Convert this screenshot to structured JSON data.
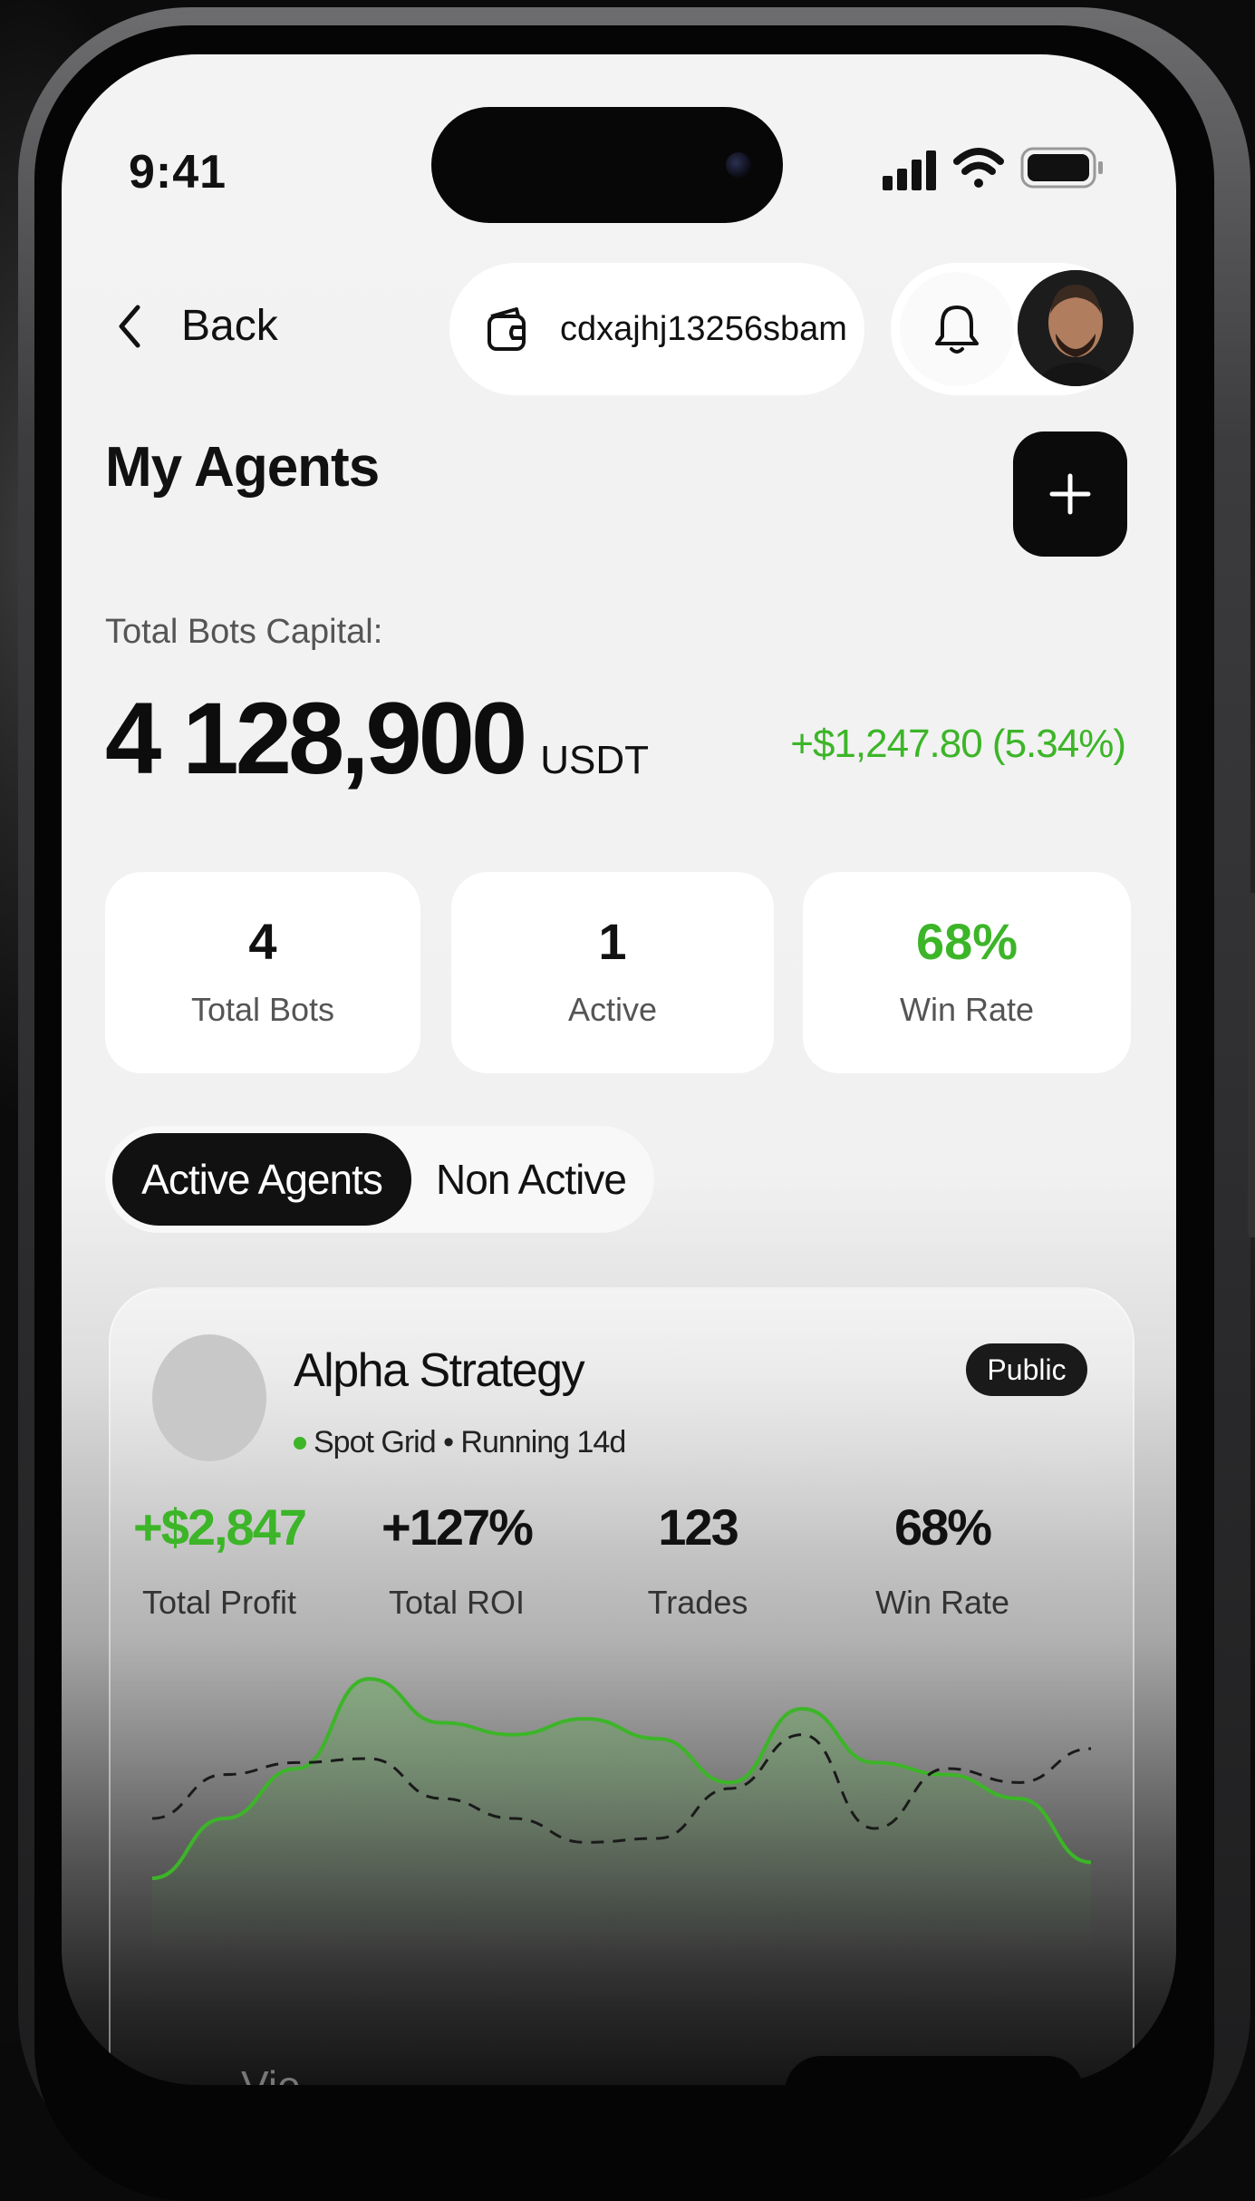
{
  "status_bar": {
    "time": "9:41"
  },
  "header": {
    "back_label": "Back",
    "wallet_address": "cdxajhj13256sbam"
  },
  "page": {
    "title": "My Agents"
  },
  "capital": {
    "label": "Total Bots Capital:",
    "value": "4 128,900",
    "unit": "USDT",
    "change": "+$1,247.80 (5.34%)"
  },
  "stats": [
    {
      "value": "4",
      "label": "Total Bots"
    },
    {
      "value": "1",
      "label": "Active"
    },
    {
      "value": "68%",
      "label": "Win Rate"
    }
  ],
  "tabs": {
    "active": "Active Agents",
    "inactive": "Non Active"
  },
  "agent": {
    "name": "Alpha Strategy",
    "meta": "Spot Grid • Running 14d",
    "badge": "Public",
    "metrics": [
      {
        "value": "+$2,847",
        "label": "Total Profit"
      },
      {
        "value": "+127%",
        "label": "Total ROI"
      },
      {
        "value": "123",
        "label": "Trades"
      },
      {
        "value": "68%",
        "label": "Win Rate"
      }
    ]
  },
  "bottom": {
    "partial_label": "Vie"
  },
  "colors": {
    "accent_green": "#3cb528",
    "dark": "#0b0b0b"
  },
  "icons": {
    "back": "chevron-left-icon",
    "wallet": "wallet-icon",
    "notification": "bell-icon",
    "add": "plus-icon",
    "signal": "signal-icon",
    "wifi": "wifi-icon",
    "battery": "battery-icon"
  },
  "chart_data": {
    "type": "line",
    "title": "",
    "series": [
      {
        "values": [
          0,
          30,
          55,
          100,
          78,
          72,
          80,
          70,
          48,
          85,
          58,
          52,
          40,
          8
        ]
      },
      {
        "values": [
          30,
          52,
          58,
          60,
          40,
          30,
          18,
          20,
          45,
          72,
          25,
          55,
          48,
          65
        ]
      }
    ]
  }
}
